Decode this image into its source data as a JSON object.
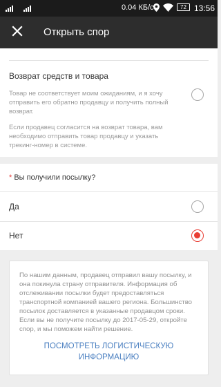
{
  "status_bar": {
    "speed": "0.04 КБ/с",
    "battery": "72",
    "time": "13:56"
  },
  "app_bar": {
    "title": "Открыть спор",
    "close_icon": "close-icon"
  },
  "refund_option": {
    "title": "Возврат средств и товара",
    "description": "Товар не соответствует моим ожиданиям, и я хочу отправить его обратно продавцу и получить полный возврат.",
    "note": "Если продавец согласится на возврат товара, вам необходимо отправить товар продавцу и указать трекинг-номер в системе.",
    "selected": false
  },
  "package_question": {
    "required_mark": "*",
    "label": "Вы получили посылку?",
    "options": [
      {
        "label": "Да",
        "selected": false
      },
      {
        "label": "Нет",
        "selected": true
      }
    ]
  },
  "info_card": {
    "text": "По нашим данным, продавец отправил вашу посылку, и она покинула страну отправителя. Информация об отслеживании посылки будет предоставляться транспортной компанией вашего региона. Большинство посылок доставляется в указанные продавцом сроки. Если вы не получите посылку до 2017-05-29, откройте спор, и мы поможем найти решение.",
    "link": "ПОСМОТРЕТЬ ЛОГИСТИЧЕСКУЮ ИНФОРМАЦИЮ"
  },
  "colors": {
    "accent": "#e93e34",
    "link": "#4a7fc0",
    "app_bar": "#2d2d2d"
  }
}
